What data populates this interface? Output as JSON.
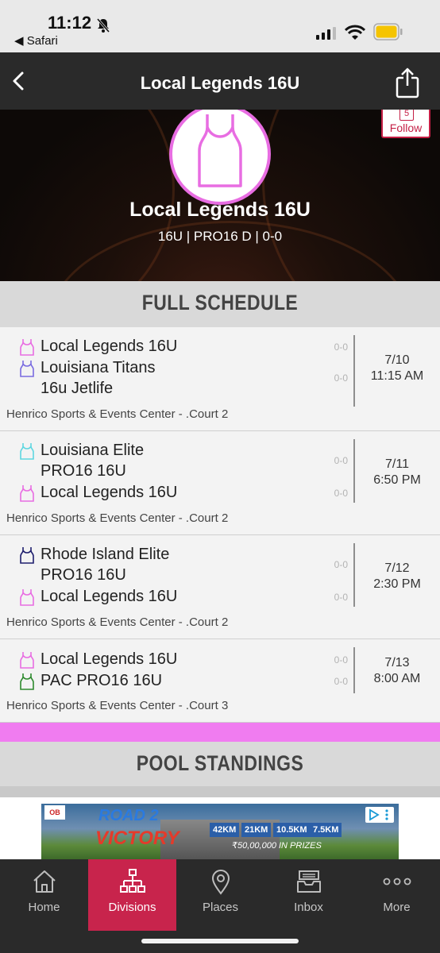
{
  "status_bar": {
    "time": "11:12",
    "back_app": "◀ Safari"
  },
  "nav": {
    "title": "Local Legends 16U"
  },
  "hero": {
    "team_name": "Local Legends 16U",
    "team_meta": "16U | PRO16 D | 0-0",
    "follow_count": "5",
    "follow_label": "Follow"
  },
  "schedule": {
    "header": "FULL SCHEDULE",
    "games": [
      {
        "team1": {
          "name": "Local Legends 16U",
          "score": "0-0",
          "jersey_color": "#e86de2"
        },
        "team2": {
          "name": "Louisiana Titans 16u Jetlife",
          "name_line1": "Louisiana Titans",
          "name_line2": "16u Jetlife",
          "score": "0-0",
          "jersey_color": "#7a6ce0"
        },
        "date": "7/10",
        "time": "11:15 AM",
        "venue": "Henrico Sports & Events Center - .Court 2"
      },
      {
        "team1": {
          "name": "Louisiana Elite PRO16 16U",
          "name_line1": "Louisiana Elite",
          "name_line2": "PRO16 16U",
          "score": "0-0",
          "jersey_color": "#5fd7e0"
        },
        "team2": {
          "name": "Local Legends 16U",
          "score": "0-0",
          "jersey_color": "#e86de2"
        },
        "date": "7/11",
        "time": "6:50 PM",
        "venue": "Henrico Sports & Events Center - .Court 2"
      },
      {
        "team1": {
          "name": "Rhode Island Elite PRO16 16U",
          "name_line1": "Rhode Island Elite",
          "name_line2": "PRO16 16U",
          "score": "0-0",
          "jersey_color": "#1f1f6e"
        },
        "team2": {
          "name": "Local Legends 16U",
          "score": "0-0",
          "jersey_color": "#e86de2"
        },
        "date": "7/12",
        "time": "2:30 PM",
        "venue": "Henrico Sports & Events Center - .Court 2"
      },
      {
        "team1": {
          "name": "Local Legends 16U",
          "score": "0-0",
          "jersey_color": "#e86de2"
        },
        "team2": {
          "name": "PAC PRO16 16U",
          "score": "0-0",
          "jersey_color": "#2e8a2e"
        },
        "date": "7/13",
        "time": "8:00 AM",
        "venue": "Henrico Sports & Events Center - .Court 3"
      }
    ]
  },
  "pool": {
    "header": "POOL STANDINGS"
  },
  "ad": {
    "logo": "OB",
    "word1": "ROAD 2",
    "word2": "VICTORY",
    "distances": [
      "42KM",
      "21KM",
      "10.5KM",
      "7.5KM"
    ],
    "prize": "₹50,00,000 IN PRIZES"
  },
  "tabs": [
    {
      "label": "Home",
      "icon": "home-icon",
      "active": false
    },
    {
      "label": "Divisions",
      "icon": "bracket-icon",
      "active": true
    },
    {
      "label": "Places",
      "icon": "location-pin-icon",
      "active": false
    },
    {
      "label": "Inbox",
      "icon": "inbox-icon",
      "active": false
    },
    {
      "label": "More",
      "icon": "more-dots-icon",
      "active": false
    }
  ],
  "colors": {
    "accent": "#c8244c",
    "jersey_primary": "#e86de2",
    "nav_bg": "#2a2a2a",
    "pink_band": "#f07cf0"
  }
}
